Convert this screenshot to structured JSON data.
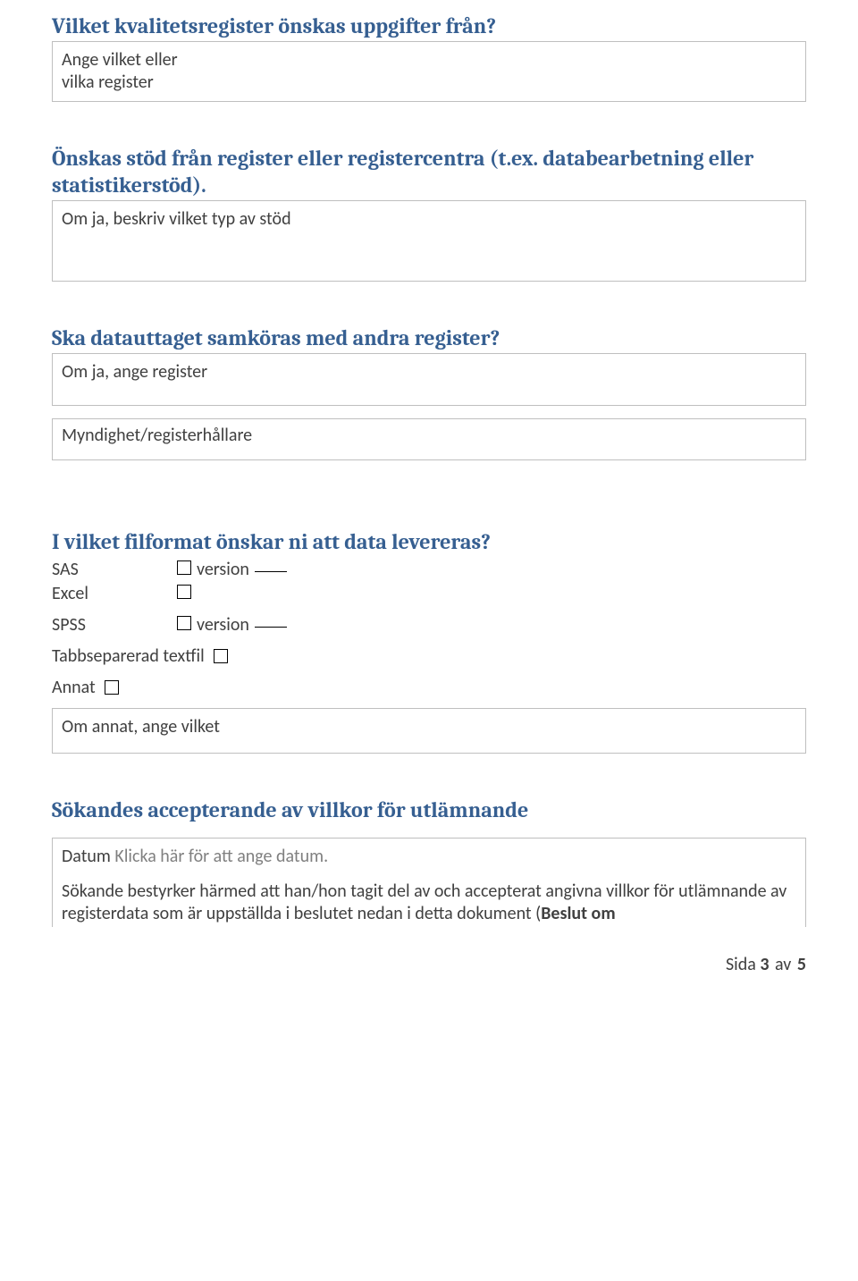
{
  "section1": {
    "heading": "Vilket kvalitetsregister önskas uppgifter från?",
    "field1_l1": "Ange vilket eller",
    "field1_l2": "vilka register"
  },
  "section2": {
    "heading": "Önskas stöd från register eller registercentra (t.ex. databearbetning eller statistikerstöd).",
    "field": "Om ja, beskriv vilket typ av stöd"
  },
  "section3": {
    "heading": "Ska datauttaget samköras med andra register?",
    "field1": "Om ja, ange register",
    "field2": "Myndighet/registerhållare"
  },
  "section4": {
    "heading": "I vilket filformat önskar ni att data levereras?",
    "sas": "SAS",
    "excel": "Excel",
    "spss": "SPSS",
    "version": "version",
    "tab": "Tabbseparerad textfil",
    "annat": "Annat",
    "annat_field": "Om annat, ange vilket"
  },
  "section5": {
    "heading": "Sökandes accepterande av villkor för utlämnande",
    "datum_label": "Datum",
    "datum_placeholder": "Klicka här för att ange datum.",
    "cert_text": "Sökande bestyrker härmed att han/hon tagit del av och accepterat angivna villkor för utlämnande av registerdata som är uppställda i beslutet nedan i detta dokument (",
    "cert_bold": "Beslut om"
  },
  "footer": {
    "sida": "Sida",
    "page": "3",
    "av": "av",
    "total": "5"
  }
}
